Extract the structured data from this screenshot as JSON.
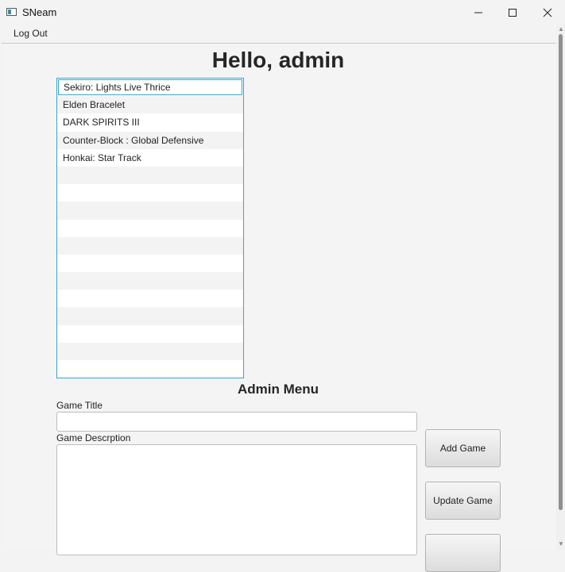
{
  "window": {
    "title": "SNeam"
  },
  "menu": {
    "logout_label": "Log Out"
  },
  "main": {
    "greeting": "Hello, admin"
  },
  "games": [
    "Sekiro: Lights Live Thrice",
    "Elden Bracelet",
    "DARK SPIRITS III",
    "Counter-Block : Global Defensive",
    "Honkai: Star Track"
  ],
  "admin": {
    "heading": "Admin Menu",
    "title_label": "Game Title",
    "title_value": "",
    "desc_label": "Game Descrption",
    "desc_value": "",
    "add_label": "Add Game",
    "update_label": "Update Game",
    "third_label": ""
  },
  "colors": {
    "accent": "#3aa5c8"
  }
}
